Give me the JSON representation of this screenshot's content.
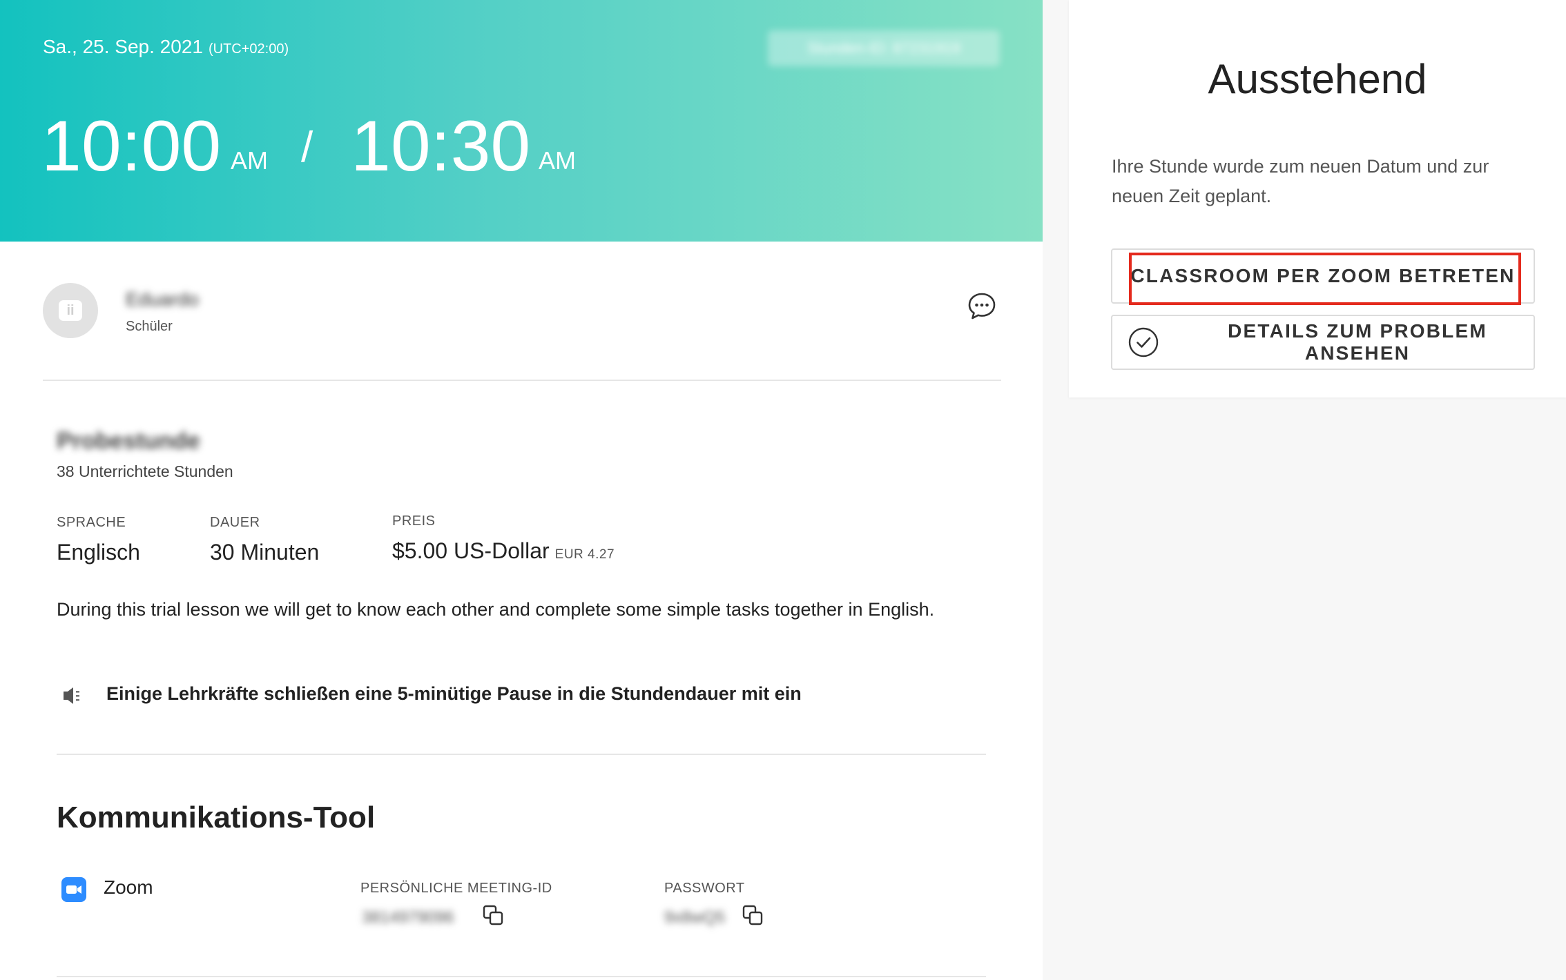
{
  "header": {
    "date": "Sa., 25. Sep. 2021",
    "timezone": "(UTC+02:00)",
    "lesson_id": "Stunden-ID: 87231919",
    "start_time": "10:00",
    "start_period": "AM",
    "separator": "/",
    "end_time": "10:30",
    "end_period": "AM"
  },
  "student": {
    "avatar_initials": "ii",
    "name": "Eduardo",
    "role": "Schüler"
  },
  "lesson": {
    "title": "Probestunde",
    "count_label": "38 Unterrichtete Stunden",
    "language_label": "SPRACHE",
    "language_value": "Englisch",
    "duration_label": "DAUER",
    "duration_value": "30 Minuten",
    "price_label": "PREIS",
    "price_value": "$5.00 US-Dollar",
    "price_local": "EUR 4.27",
    "description": "During this trial lesson we will get to know each other and complete some simple tasks together in English.",
    "notice": "Einige Lehrkräfte schließen eine 5-minütige Pause in die Stundendauer mit ein"
  },
  "communication": {
    "title": "Kommunikations-Tool",
    "tool_name": "Zoom",
    "meeting_id_label": "PERSÖNLICHE MEETING-ID",
    "meeting_id_value": "3814979096",
    "password_label": "PASSWORT",
    "password_value": "9x8wQ5"
  },
  "status_panel": {
    "title": "Ausstehend",
    "description": "Ihre Stunde wurde zum neuen Datum und zur neuen Zeit geplant.",
    "zoom_button": "CLASSROOM PER ZOOM BETRETEN",
    "details_button": "DETAILS ZUM PROBLEM ANSEHEN"
  },
  "icons": {
    "chat": "chat-bubble-icon",
    "notice": "speaker-icon",
    "tool": "zoom-camera-icon",
    "copy": "copy-icon",
    "details": "check-circle-icon"
  },
  "colors": {
    "header_gradient_start": "#13c2bf",
    "header_gradient_end": "#87e1c5",
    "zoom_blue": "#2d8cff",
    "highlight_red": "#e42a1d"
  }
}
